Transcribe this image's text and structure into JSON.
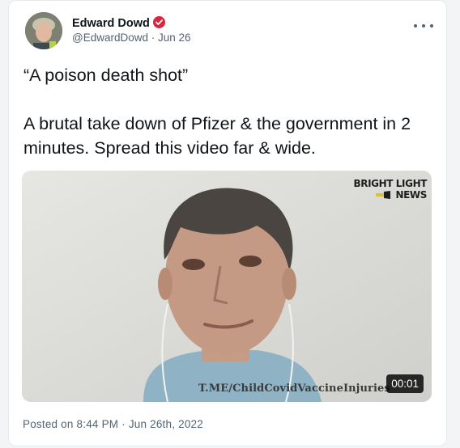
{
  "author": {
    "name": "Edward Dowd",
    "handle": "@EdwardDowd",
    "date": "Jun 26",
    "separator": " · "
  },
  "tweet": {
    "quote": "“A poison death shot”",
    "body": "A brutal take down of Pfizer & the government in 2 minutes. Spread this video far & wide."
  },
  "video": {
    "brand_line1": "BRIGHT LIGHT",
    "brand_line2": "NEWS",
    "watermark": "T.ME/ChildCovidVaccineInjuries",
    "duration": "00:01"
  },
  "footer": {
    "posted": "Posted on 8:44 PM · Jun 26th, 2022"
  },
  "colors": {
    "verified_badge": "#d7263d",
    "text": "#0f1419",
    "muted": "#536471"
  },
  "icons": [
    "verified-badge-icon",
    "more-options-icon",
    "brand-logo-icon"
  ]
}
